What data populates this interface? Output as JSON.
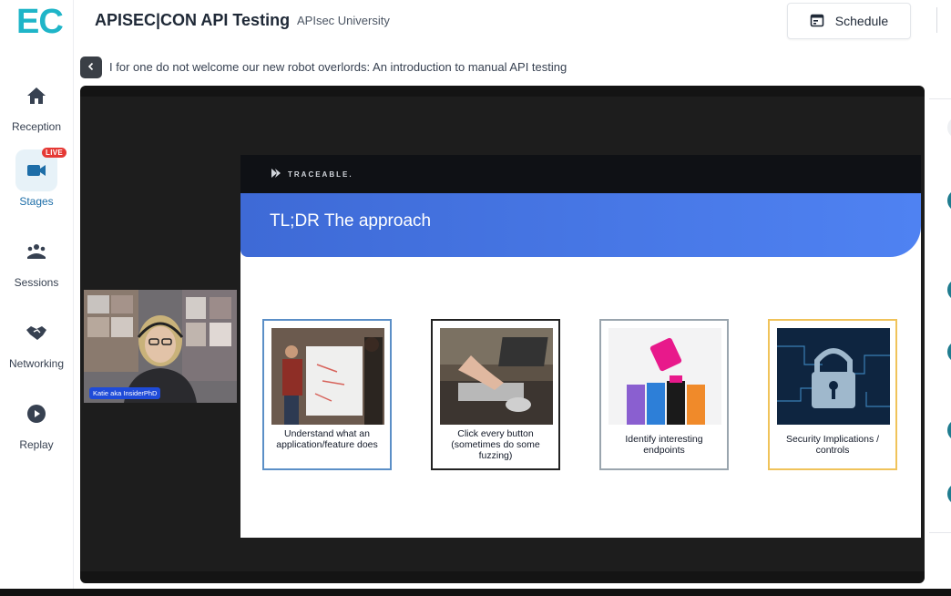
{
  "app": {
    "logo_text": "EC"
  },
  "sidebar": {
    "items": [
      {
        "label": "Reception",
        "icon": "home-icon"
      },
      {
        "label": "Stages",
        "icon": "video-camera-icon",
        "badge": "LIVE"
      },
      {
        "label": "Sessions",
        "icon": "group-icon"
      },
      {
        "label": "Networking",
        "icon": "handshake-icon"
      },
      {
        "label": "Replay",
        "icon": "play-circle-icon"
      }
    ]
  },
  "header": {
    "title": "APISEC|CON API Testing",
    "organizer": "APIsec University",
    "schedule_label": "Schedule"
  },
  "session": {
    "title": "I for one do not welcome our new robot overlords: An introduction to manual API testing"
  },
  "slide": {
    "brand": "TRACEABLE.",
    "heading": "TL;DR The approach",
    "cards": [
      {
        "caption": "Understand what an application/feature does",
        "border": "#5b8fc7"
      },
      {
        "caption": "Click every button (sometimes do some fuzzing)",
        "border": "#222222"
      },
      {
        "caption": "Identify interesting endpoints",
        "border": "#9aa5ae"
      },
      {
        "caption": "Security Implications / controls",
        "border": "#f0c35a"
      }
    ]
  },
  "webcam": {
    "name_tag": "Katie aka InsiderPhD"
  },
  "colors": {
    "accent": "#1fb5c8",
    "live": "#e53935",
    "banner": "#4a78e8"
  }
}
